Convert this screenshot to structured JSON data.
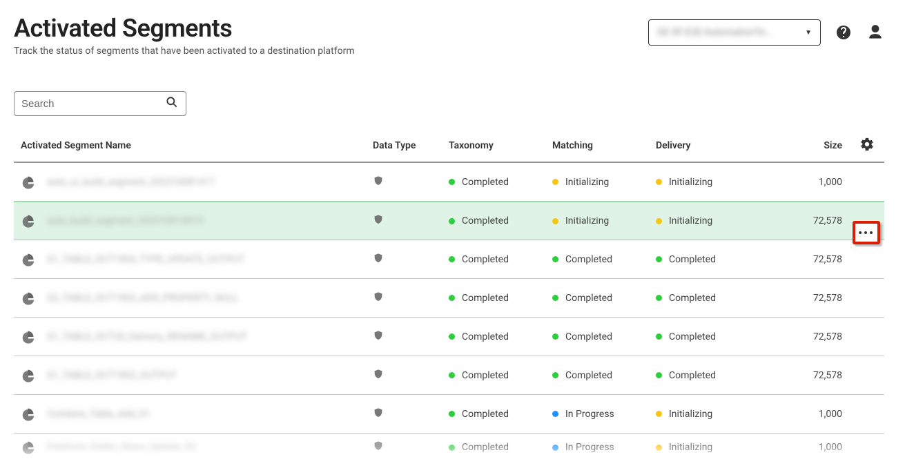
{
  "header": {
    "title": "Activated Segments",
    "subtitle": "Track the status of segments that have been activated to a destination platform",
    "account_label": "GE SF-E2E-AutomationTe..."
  },
  "search": {
    "placeholder": "Search"
  },
  "table": {
    "headers": {
      "name": "Activated Segment Name",
      "data_type": "Data Type",
      "taxonomy": "Taxonomy",
      "matching": "Matching",
      "delivery": "Delivery",
      "size": "Size"
    },
    "rows": [
      {
        "name": "auto_ui_build_segment_202310081417",
        "taxonomy": {
          "status": "Completed",
          "color": "green"
        },
        "matching": {
          "status": "Initializing",
          "color": "yellow"
        },
        "delivery": {
          "status": "Initializing",
          "color": "yellow"
        },
        "size": "1,000",
        "highlight": false,
        "show_more": false
      },
      {
        "name": "auto_build_segment_202310014913",
        "taxonomy": {
          "status": "Completed",
          "color": "green"
        },
        "matching": {
          "status": "Initializing",
          "color": "yellow"
        },
        "delivery": {
          "status": "Initializing",
          "color": "yellow"
        },
        "size": "72,578",
        "highlight": true,
        "show_more": true
      },
      {
        "name": "S1_TABLE_OCT1904_TYPE_UPDATE_OUTPUT",
        "taxonomy": {
          "status": "Completed",
          "color": "green"
        },
        "matching": {
          "status": "Completed",
          "color": "green"
        },
        "delivery": {
          "status": "Completed",
          "color": "green"
        },
        "size": "72,578",
        "highlight": false,
        "show_more": false
      },
      {
        "name": "S2_TABLE_OCT1903_ADD_PROPERTY_NULL",
        "taxonomy": {
          "status": "Completed",
          "color": "green"
        },
        "matching": {
          "status": "Completed",
          "color": "green"
        },
        "delivery": {
          "status": "Completed",
          "color": "green"
        },
        "size": "72,578",
        "highlight": false,
        "show_more": false
      },
      {
        "name": "S1_TABLE_OCT20_Delivery_RENAME_OUTPUT",
        "taxonomy": {
          "status": "Completed",
          "color": "green"
        },
        "matching": {
          "status": "Completed",
          "color": "green"
        },
        "delivery": {
          "status": "Completed",
          "color": "green"
        },
        "size": "72,578",
        "highlight": false,
        "show_more": false
      },
      {
        "name": "S1_TABLE_OCT1902_OUTPUT",
        "taxonomy": {
          "status": "Completed",
          "color": "green"
        },
        "matching": {
          "status": "Completed",
          "color": "green"
        },
        "delivery": {
          "status": "Completed",
          "color": "green"
        },
        "size": "72,578",
        "highlight": false,
        "show_more": false
      },
      {
        "name": "Combine_Table_Add_S1",
        "taxonomy": {
          "status": "Completed",
          "color": "green"
        },
        "matching": {
          "status": "In Progress",
          "color": "blue"
        },
        "delivery": {
          "status": "Initializing",
          "color": "yellow"
        },
        "size": "1,000",
        "highlight": false,
        "show_more": false
      },
      {
        "name": "Freeform_Public_Rows_Update_S2",
        "taxonomy": {
          "status": "Completed",
          "color": "green"
        },
        "matching": {
          "status": "In Progress",
          "color": "blue"
        },
        "delivery": {
          "status": "Initializing",
          "color": "yellow"
        },
        "size": "1,000",
        "highlight": false,
        "show_more": false,
        "partial": true
      }
    ]
  }
}
